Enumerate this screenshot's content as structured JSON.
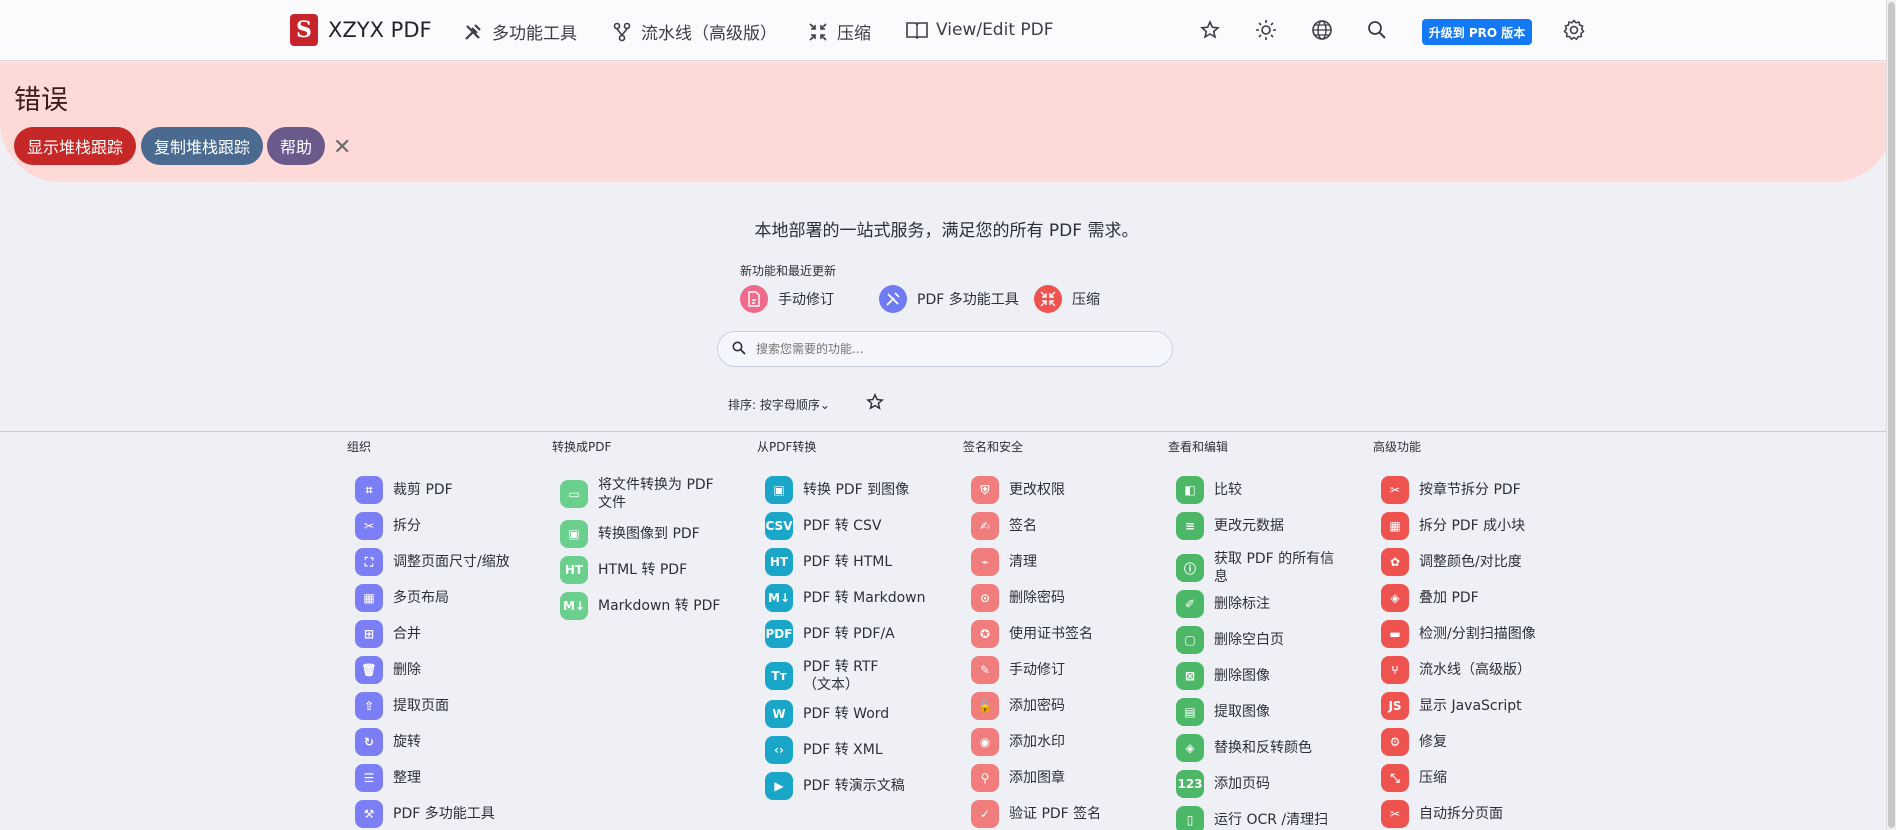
{
  "nav": {
    "logo_mark": "S",
    "brand": "XZYX PDF",
    "items": [
      {
        "label": "多功能工具",
        "icon": "tools-icon"
      },
      {
        "label": "流水线（高级版）",
        "icon": "pipeline-icon"
      },
      {
        "label": "压缩",
        "icon": "compress-icon"
      },
      {
        "label": "View/Edit PDF",
        "icon": "book-icon"
      }
    ],
    "pro_label": "升级到 PRO 版本"
  },
  "error": {
    "title": "错误",
    "show_trace": "显示堆栈跟踪",
    "copy_trace": "复制堆栈跟踪",
    "help": "帮助",
    "close": "✕"
  },
  "hero": {
    "tagline": "本地部署的一站式服务，满足您的所有 PDF 需求。",
    "new_label": "新功能和最近更新",
    "chips": [
      {
        "label": "手动修订",
        "color": "#f06a8a"
      },
      {
        "label": "PDF 多功能工具",
        "color": "#6e7bf2"
      },
      {
        "label": "压缩",
        "color": "#ef5350"
      }
    ],
    "search_placeholder": "搜索您需要的功能...",
    "sort_label": "排序: 按字母顺序⌄"
  },
  "colors": {
    "organize": "#7b7ef4",
    "to_pdf": "#6bcf8e",
    "from_pdf": "#1aa6c8",
    "security": "#f07c7c",
    "view_edit": "#4cb867",
    "advanced": "#ef5350",
    "error_red": "#c62828",
    "error_blue": "#4a6a90",
    "error_purple": "#6a5a8c",
    "pro_blue": "#1479f5"
  },
  "categories": [
    {
      "title": "组织",
      "tools": [
        "裁剪 PDF",
        "拆分",
        "调整页面尺寸/缩放",
        "多页布局",
        "合并",
        "删除",
        "提取页面",
        "旋转",
        "整理",
        "PDF 多功能工具"
      ]
    },
    {
      "title": "转换成PDF",
      "tools": [
        "将文件转换为 PDF 文件",
        "转换图像到 PDF",
        "HTML 转 PDF",
        "Markdown 转 PDF"
      ]
    },
    {
      "title": "从PDF转换",
      "tools": [
        "转换 PDF 到图像",
        "PDF 转 CSV",
        "PDF 转 HTML",
        "PDF 转 Markdown",
        "PDF 转 PDF/A",
        "PDF 转 RTF（文本）",
        "PDF 转 Word",
        "PDF 转 XML",
        "PDF 转演示文稿"
      ]
    },
    {
      "title": "签名和安全",
      "tools": [
        "更改权限",
        "签名",
        "清理",
        "删除密码",
        "使用证书签名",
        "手动修订",
        "添加密码",
        "添加水印",
        "添加图章",
        "验证 PDF 签名"
      ]
    },
    {
      "title": "查看和编辑",
      "tools": [
        "比较",
        "更改元数据",
        "获取 PDF 的所有信息",
        "删除标注",
        "删除空白页",
        "删除图像",
        "提取图像",
        "替换和反转颜色",
        "添加页码",
        "运行 OCR /清理扫"
      ]
    },
    {
      "title": "高级功能",
      "tools": [
        "按章节拆分 PDF",
        "拆分 PDF 成小块",
        "调整颜色/对比度",
        "叠加 PDF",
        "检测/分割扫描图像",
        "流水线（高级版）",
        "显示 JavaScript",
        "修复",
        "压缩",
        "自动拆分页面"
      ]
    }
  ]
}
